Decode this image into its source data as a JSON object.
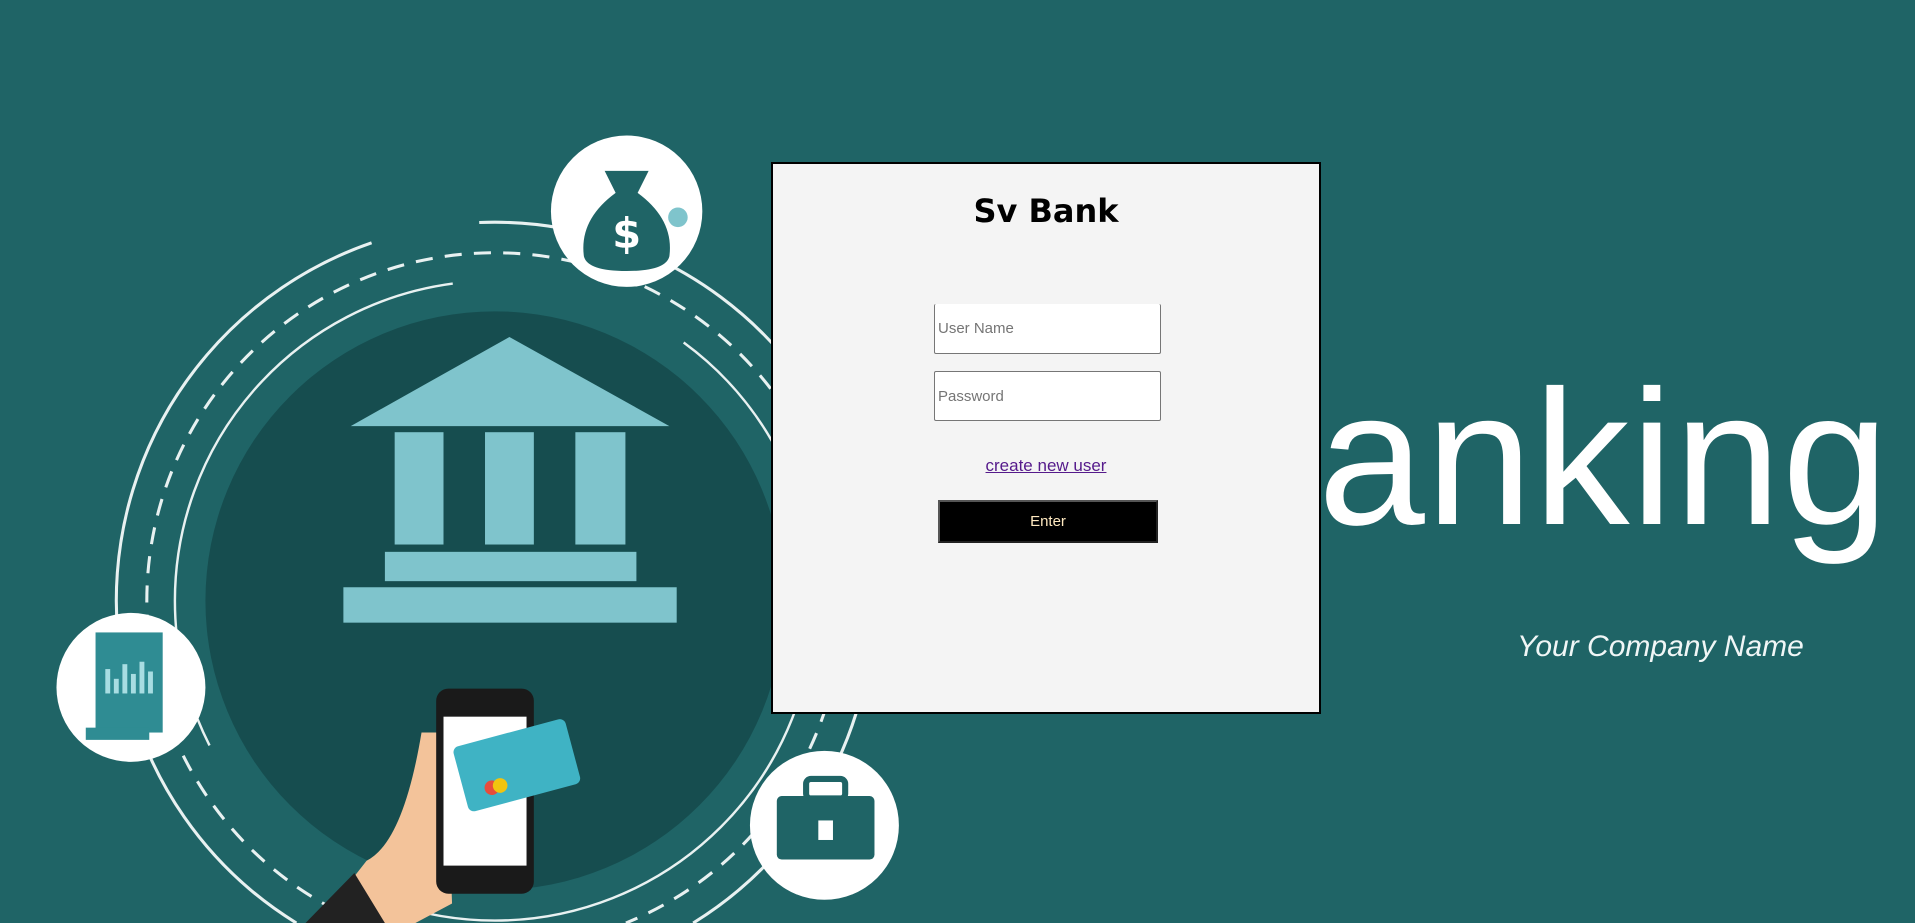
{
  "background": {
    "hero_word": "anking",
    "company_name": "Your Company Name",
    "colors": {
      "background": "#1f6466",
      "circle": "#164d4f",
      "accent": "#7fc4cc"
    }
  },
  "login": {
    "title": "Sv Bank",
    "username_placeholder": "User Name",
    "password_placeholder": "Password",
    "create_user_link": "create new user",
    "enter_label": "Enter"
  }
}
